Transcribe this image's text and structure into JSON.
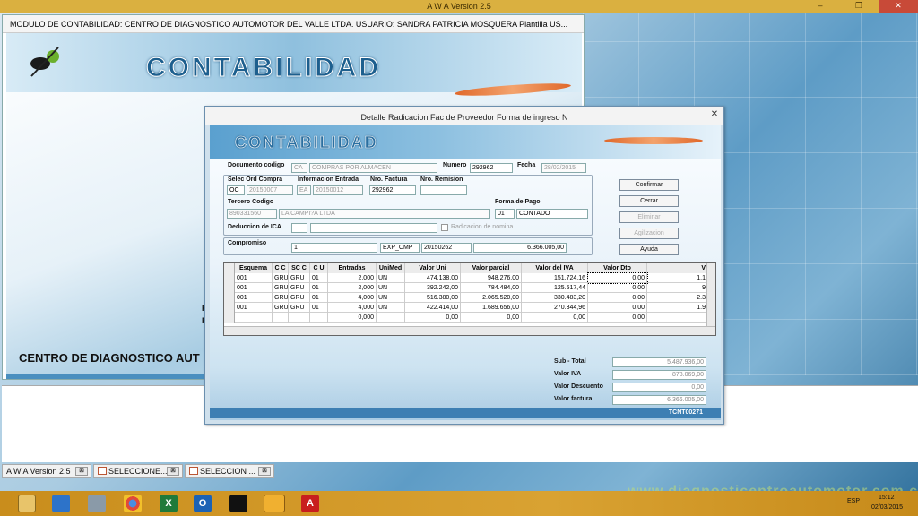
{
  "app": {
    "title": "A W A Version 2.5",
    "controls": {
      "minimize": "–",
      "restore": "❐",
      "close": "✕"
    }
  },
  "mainwin": {
    "header": "MODULO DE CONTABILIDAD: CENTRO DE DIAGNOSTICO AUTOMOTOR DEL VALLE LTDA.    USUARIO:  SANDRA PATRICIA MOSQUERA  Plantilla US...",
    "logo": "CONTABILIDAD",
    "company_partial": "CENTRO DE DIAGNOSTICO AUT",
    "fragments": [
      "F",
      "F"
    ]
  },
  "dialog": {
    "title": "Detalle Radicacion Fac de Proveedor  Forma de ingreso N",
    "logo": "CONTABILIDAD",
    "labels": {
      "documento": "Documento codigo",
      "numero": "Numero",
      "fecha": "Fecha",
      "selec": "Selec Ord Compra",
      "info": "Informacion Entrada",
      "nrofac": "Nro. Factura",
      "nrorem": "Nro. Remision",
      "tercero": "Tercero Codigo",
      "forma": "Forma de Pago",
      "ica": "Deduccion de ICA",
      "radicacion": "Radicacion de nomina",
      "compromiso": "Compromiso"
    },
    "fields": {
      "doc_code": "CA",
      "doc_desc": "COMPRAS POR ALMACEN",
      "numero": "292962",
      "fecha": "28/02/2015",
      "oc_type": "OC",
      "oc_num": "20150007",
      "ea_type": "EA",
      "ea_num": "20150012",
      "nro_factura": "292962",
      "nro_remision": "",
      "tercero_code": "890331560",
      "tercero_name": "LA CAMPI?A LTDA",
      "forma_code": "01",
      "forma_desc": "CONTADO",
      "ica_code": "",
      "ica_desc": "",
      "comp_num": "1",
      "comp_type": "EXP_CMP",
      "comp_code": "20150262",
      "comp_value": "6.366.005,00"
    },
    "buttons": {
      "confirmar": "Confirmar",
      "cerrar": "Cerrar",
      "eliminar": "Eliminar",
      "agilizar": "Agilizacion",
      "ayuda": "Ayuda"
    },
    "table": {
      "headers": [
        "Esquema",
        "C C",
        "SC C",
        "C U",
        "Entradas",
        "UniMed",
        "Valor Uni",
        "Valor parcial",
        "Valor del IVA",
        "Valor Dto",
        "V"
      ],
      "rows": [
        [
          "001",
          "GRU",
          "GRU",
          "01",
          "2,000",
          "UN",
          "474.138,00",
          "948.276,00",
          "151.724,16",
          "0,00",
          "1.1"
        ],
        [
          "001",
          "GRU",
          "GRU",
          "01",
          "2,000",
          "UN",
          "392.242,00",
          "784.484,00",
          "125.517,44",
          "0,00",
          "9"
        ],
        [
          "001",
          "GRU",
          "GRU",
          "01",
          "4,000",
          "UN",
          "516.380,00",
          "2.065.520,00",
          "330.483,20",
          "0,00",
          "2.3"
        ],
        [
          "001",
          "GRU",
          "GRU",
          "01",
          "4,000",
          "UN",
          "422.414,00",
          "1.689.656,00",
          "270.344,96",
          "0,00",
          "1.9"
        ],
        [
          "",
          "",
          "",
          "",
          "0,000",
          "",
          "0,00",
          "0,00",
          "0,00",
          "0,00",
          ""
        ]
      ]
    },
    "totals": [
      {
        "label": "Sub - Total",
        "value": "5.487.936,00"
      },
      {
        "label": "Valor IVA",
        "value": "878.069,00"
      },
      {
        "label": "Valor Descuento",
        "value": "0,00"
      },
      {
        "label": "Valor factura",
        "value": "6.366.005,00"
      }
    ],
    "footer": "TCNT00271"
  },
  "tabs": [
    {
      "label": "A W A Version 2.5",
      "close": "⊠"
    },
    {
      "label": "SELECCIONE...",
      "close": "⊠"
    },
    {
      "label": "SELECCION ...",
      "close": "⊠"
    }
  ],
  "watermark": "www.diagnosticentroautomotor.com.co",
  "taskbar": {
    "lang": "ESP",
    "time": "15:12",
    "date": "02/03/2015",
    "excel": "X",
    "word": "O",
    "pdf": "A"
  }
}
